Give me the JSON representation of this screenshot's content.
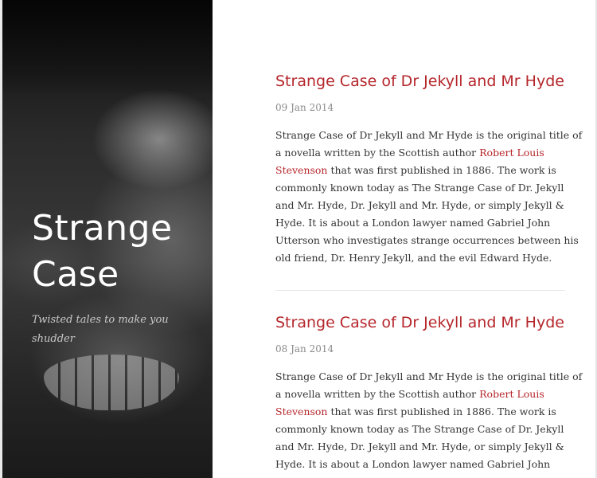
{
  "site": {
    "title_line1": "Strange",
    "title_line2": "Case",
    "tagline_line1": "Twisted tales to make you",
    "tagline_line2": "shudder"
  },
  "posts": [
    {
      "title": "Strange Case of Dr Jekyll and Mr Hyde",
      "date": "09 Jan 2014",
      "lines": [
        "Strange Case of Dr Jekyll and Mr Hyde is the original title of",
        "a novella written by the Scottish author ",
        "Robert Louis",
        "Stevenson",
        " that was first published in 1886. The work is",
        "commonly known today as The Strange Case of Dr. Jekyll",
        "and Mr. Hyde, Dr. Jekyll and Mr. Hyde, or simply Jekyll &",
        "Hyde. It is about a London lawyer named Gabriel John",
        "Utterson who investigates strange occurrences between his",
        "old friend, Dr. Henry Jekyll, and the evil Edward Hyde."
      ]
    },
    {
      "title": "Strange Case of Dr Jekyll and Mr Hyde",
      "date": "08 Jan 2014",
      "lines": [
        "Strange Case of Dr Jekyll and Mr Hyde is the original title of",
        "a novella written by the Scottish author ",
        "Robert Louis",
        "Stevenson",
        " that was first published in 1886. The work is",
        "commonly known today as The Strange Case of Dr. Jekyll",
        "and Mr. Hyde, Dr. Jekyll and Mr. Hyde, or simply Jekyll &",
        "Hyde. It is about a London lawyer named Gabriel John"
      ]
    }
  ],
  "colors": {
    "accent": "#b5262b",
    "text": "#333333",
    "date": "#8a8a8a"
  }
}
